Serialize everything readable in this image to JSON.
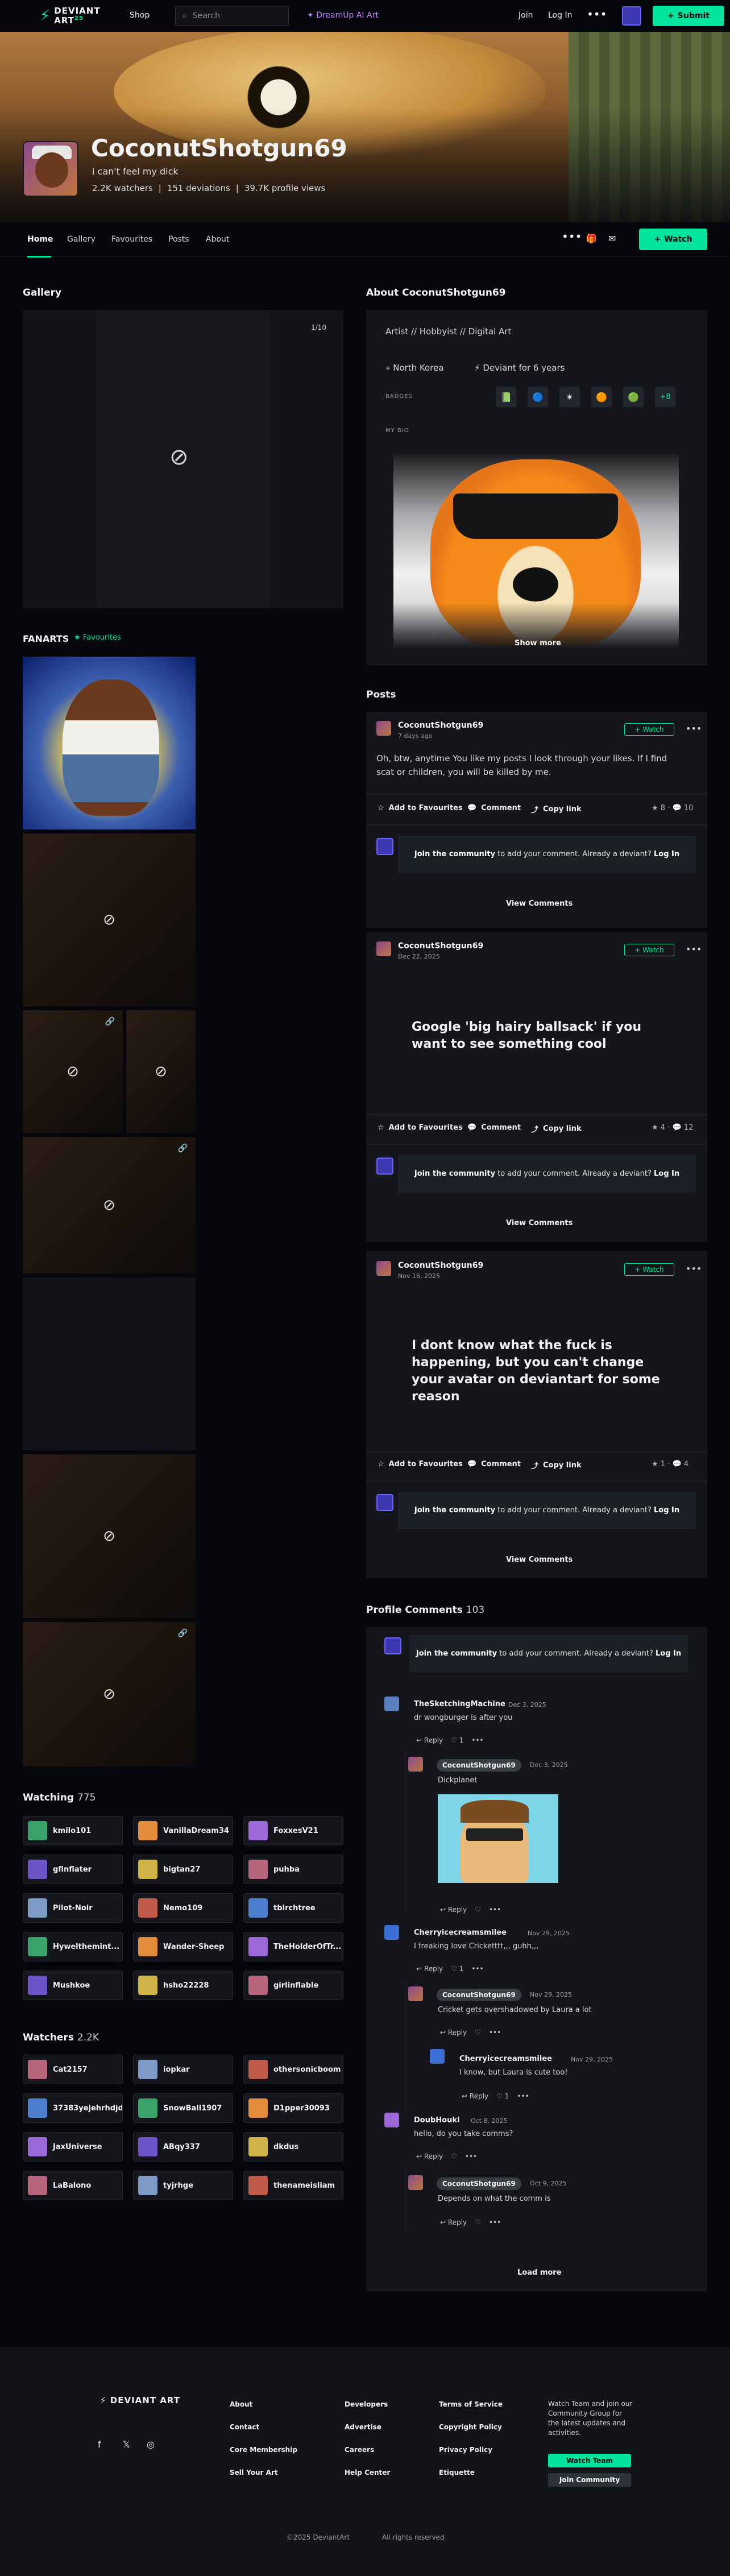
{
  "topbar": {
    "logo_line1": "DEVIANT",
    "logo_line2": "ART",
    "logo_sub": "25",
    "shop": "Shop",
    "search_placeholder": "Search",
    "dreamup": "DreamUp AI Art",
    "join": "Join",
    "login": "Log In",
    "more": "•••",
    "submit": "Submit"
  },
  "profile": {
    "name": "CoconutShotgun69",
    "tagline": "i can't feel my dick",
    "watchers": "2.2K watchers",
    "deviations": "151 deviations",
    "views": "39.7K profile views"
  },
  "tabs": [
    "Home",
    "Gallery",
    "Favourites",
    "Posts",
    "About"
  ],
  "watch_label": "Watch",
  "gallery": {
    "title": "Gallery",
    "counter": "1/10"
  },
  "fanarts": {
    "title": "FANARTS",
    "tag": "Favourites"
  },
  "about": {
    "title": "About CoconutShotgun69",
    "roles": "Artist  //  Hobbyist  //  Digital Art",
    "location": "North Korea",
    "member": "Deviant for 6 years",
    "badges_label": "BADGES",
    "badges_more": "+8",
    "bio_label": "MY BIO",
    "show_more": "Show more"
  },
  "posts": {
    "title": "Posts",
    "items": [
      {
        "author": "CoconutShotgun69",
        "date": "7 days ago",
        "text": "Oh, btw, anytime You like my posts I look through your likes. If I find scat or children, you will be killed by me.",
        "stars": "8",
        "comments": "10"
      },
      {
        "author": "CoconutShotgun69",
        "date": "Dec 22, 2025",
        "text": "Google 'big hairy ballsack' if you want to see something cool",
        "stars": "4",
        "comments": "12"
      },
      {
        "author": "CoconutShotgun69",
        "date": "Nov 16, 2025",
        "text": "I dont know what the fuck is happening, but you can't change your avatar on deviantart for some reason",
        "stars": "1",
        "comments": "4"
      }
    ],
    "watch": "+ Watch",
    "add_fav": "Add to Favourites",
    "comment": "Comment",
    "copy_link": "Copy link",
    "join_bold": "Join the community",
    "join_rest": " to add your comment. Already a deviant? ",
    "login": "Log In",
    "view_comments": "View Comments"
  },
  "profile_comments": {
    "title": "Profile Comments",
    "count": "103",
    "join_bold": "Join the community",
    "join_rest": " to add your comment. Already a deviant? ",
    "login": "Log In",
    "reply": "Reply",
    "load_more": "Load more",
    "items": [
      {
        "author": "TheSketchingMachine",
        "date": "Dec 3, 2025",
        "text": "dr wongburger is after you",
        "likes": "1"
      },
      {
        "author": "CoconutShotgun69",
        "date": "Dec 3, 2025",
        "text": "Dickplanet"
      },
      {
        "author": "Cherryicecreamsmilee",
        "date": "Nov 29, 2025",
        "text": "I freaking love Cricketttt,,, guhh,,,",
        "likes": "1"
      },
      {
        "author": "CoconutShotgun69",
        "date": "Nov 29, 2025",
        "text": "Cricket gets overshadowed by Laura a lot"
      },
      {
        "author": "Cherryicecreamsmilee",
        "date": "Nov 29, 2025",
        "text": "I know, but Laura is cute too!",
        "likes": "1"
      },
      {
        "author": "DoubHouki",
        "date": "Oct 8, 2025",
        "text": "hello, do you take comms?"
      },
      {
        "author": "CoconutShotgun69",
        "date": "Oct 9, 2025",
        "text": "Depends on what the comm is"
      }
    ]
  },
  "watching": {
    "title": "Watching",
    "count": "775",
    "users": [
      "kmilo101",
      "VanillaDream34",
      "FoxxesV21",
      "gfinflater",
      "bigtan27",
      "puhba",
      "Pilot-Noir",
      "Nemo109",
      "tbirchtree",
      "Hywelthemint...",
      "Wander-Sheep",
      "TheHolderOfTr...",
      "Mushkoe",
      "hsho22228",
      "girlinflable"
    ]
  },
  "watchers": {
    "title": "Watchers",
    "count": "2.2K",
    "users": [
      "Cat2157",
      "iopkar",
      "othersonicboom",
      "37383yejehrhdjd",
      "SnowBall1907",
      "D1pper30093",
      "JaxUniverse",
      "ABqy337",
      "dkdus",
      "LaBalono",
      "tyjrhge",
      "thenameisliam"
    ]
  },
  "footer": {
    "logo": "DEVIANT ART",
    "col1": [
      "About",
      "Contact",
      "Core Membership",
      "Sell Your Art"
    ],
    "col2": [
      "Developers",
      "Advertise",
      "Careers",
      "Help Center"
    ],
    "col3": [
      "Terms of Service",
      "Copyright Policy",
      "Privacy Policy",
      "Etiquette"
    ],
    "cta_text": "Watch Team and join our Community Group for the latest updates and activities.",
    "watch_team": "Watch Team",
    "join_community": "Join Community",
    "copyright": "©2025 DeviantArt",
    "rights": "All rights reserved"
  },
  "colors": {
    "accent": "#00e59b",
    "bg": "#06070d",
    "panel": "#14161c",
    "dreamup": "#c884ff",
    "self_avatar": "#3d37b2"
  }
}
